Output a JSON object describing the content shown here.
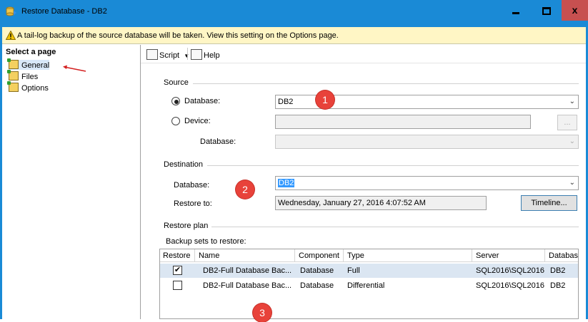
{
  "window": {
    "title": "Restore Database - DB2",
    "colors": {
      "titlebar": "#1a8ad6",
      "close": "#c75050",
      "selection": "#3399ff",
      "badge": "#e8423a"
    }
  },
  "infobar": {
    "text": "A tail-log backup of the source database will be taken. View this setting on the Options page."
  },
  "sidebar": {
    "header": "Select a page",
    "items": [
      {
        "label": "General"
      },
      {
        "label": "Files"
      },
      {
        "label": "Options"
      }
    ]
  },
  "toolbar": {
    "script_label": "Script",
    "help_label": "Help"
  },
  "source": {
    "header": "Source",
    "database_radio_label": "Database:",
    "database_value": "DB2",
    "device_radio_label": "Device:",
    "device_value": "",
    "device_browse": "...",
    "device_database_label": "Database:",
    "device_database_value": ""
  },
  "destination": {
    "header": "Destination",
    "database_label": "Database:",
    "database_value": "DB2",
    "restore_to_label": "Restore to:",
    "restore_to_value": "Wednesday, January 27, 2016 4:07:52 AM",
    "timeline_button": "Timeline..."
  },
  "restore_plan": {
    "header": "Restore plan",
    "backup_sets_label": "Backup sets to restore:",
    "columns": [
      "Restore",
      "Name",
      "Component",
      "Type",
      "Server",
      "Database"
    ],
    "rows": [
      {
        "checked": "✔",
        "name": "DB2-Full Database Bac...",
        "component": "Database",
        "type": "Full",
        "server": "SQL2016\\SQL2016",
        "database": "DB2"
      },
      {
        "checked": "",
        "name": "DB2-Full Database Bac...",
        "component": "Database",
        "type": "Differential",
        "server": "SQL2016\\SQL2016",
        "database": "DB2"
      }
    ]
  },
  "annotations": {
    "badge1": "1",
    "badge2": "2",
    "badge3": "3"
  }
}
